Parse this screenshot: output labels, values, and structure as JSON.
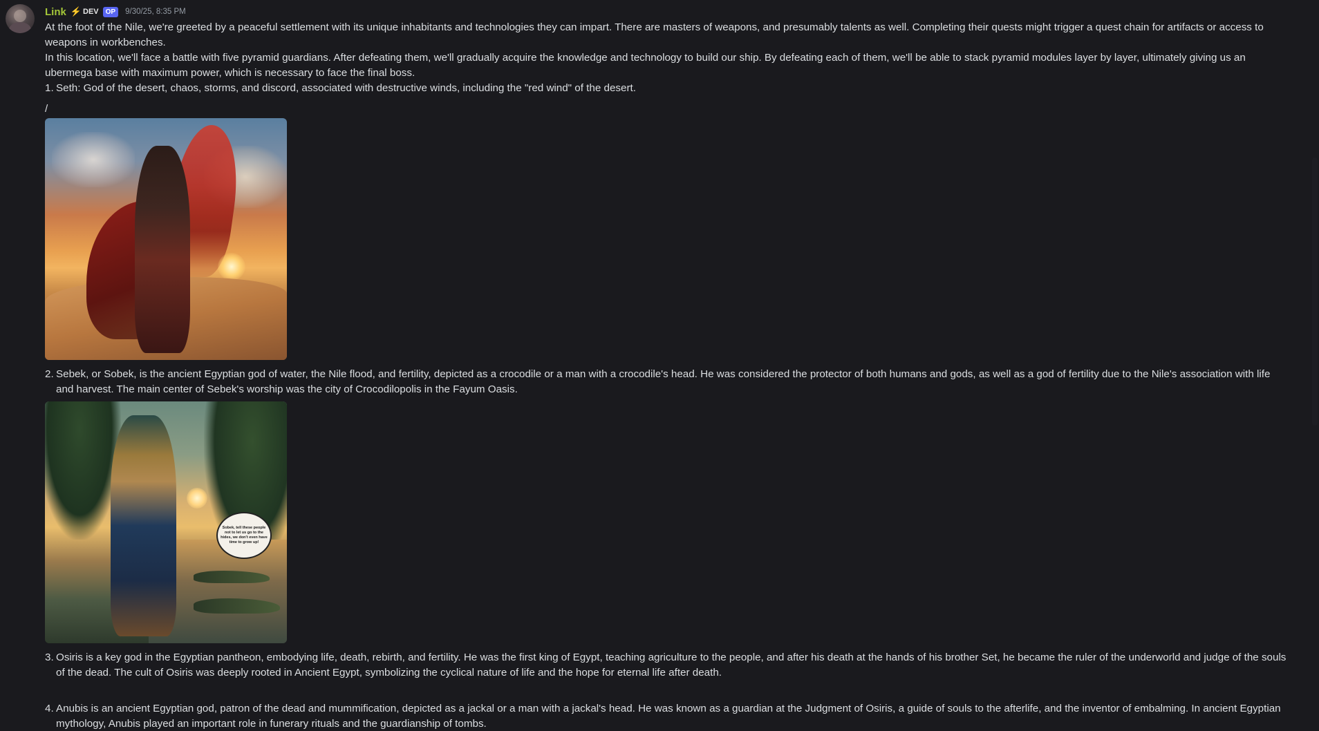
{
  "message": {
    "author": "Link",
    "role_tag": "DEV",
    "op_badge": "OP",
    "timestamp": "9/30/25, 8:35 PM",
    "intro": [
      "At the foot of the Nile, we're greeted by a peaceful settlement with its unique inhabitants and technologies they can impart. There are masters of weapons, and presumably talents as well. Completing their quests might trigger a quest chain for artifacts or access to weapons in workbenches.",
      "In this location, we'll face a battle with five pyramid guardians. After defeating them, we'll gradually acquire the knowledge and technology to build our ship. By defeating each of them, we'll be able to stack pyramid modules layer by layer, ultimately giving us an ubermega base with maximum power, which is necessary to face the final boss."
    ],
    "items": [
      {
        "num": "1.",
        "text": "Seth: God of the desert, chaos, storms, and discord, associated with destructive winds, including the \"red wind\" of the desert."
      },
      {
        "num": "2.",
        "text": "Sebek, or Sobek, is the ancient Egyptian god of water, the Nile flood, and fertility, depicted as a crocodile or a man with a crocodile's head. He was considered the protector of both humans and gods, as well as a god of fertility due to the Nile's association with life and harvest. The main center of Sebek's worship was the city of Crocodilopolis in the Fayum Oasis."
      },
      {
        "num": "3.",
        "text": "Osiris is a key god in the Egyptian pantheon, embodying life, death, rebirth, and fertility. He was the first king of Egypt, teaching agriculture to the people, and after his death at the hands of his brother Set, he became the ruler of the underworld and judge of the souls of the dead. The cult of Osiris was deeply rooted in Ancient Egypt, symbolizing the cyclical nature of life and the hope for eternal life after death."
      },
      {
        "num": "4.",
        "text": "Anubis is an ancient Egyptian god, patron of the dead and mummification, depicted as a jackal or a man with a jackal's head. He was known as a guardian at the Judgment of Osiris, a guide of souls to the afterlife, and the inventor of embalming. In ancient Egyptian mythology, Anubis played an important role in funerary rituals and the guardianship of tombs."
      }
    ],
    "slash": "/",
    "sobek_speech": "Sobek, tell these people not to let us go to the hides, we don't even have time to grow up!"
  },
  "icons": {
    "role_icon": "bolt-icon"
  }
}
